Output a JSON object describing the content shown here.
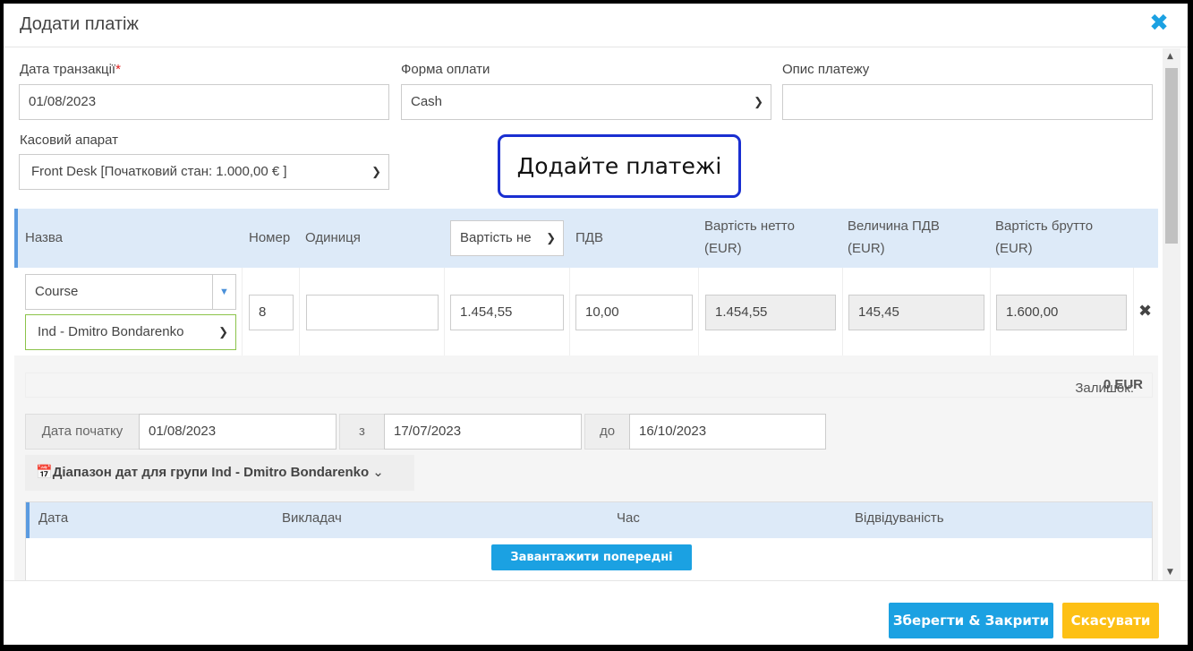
{
  "dialog": {
    "title": "Додати платіж",
    "close_icon": "close-icon"
  },
  "form": {
    "transaction_date": {
      "label": "Дата транзакції",
      "required_mark": "*",
      "value": "01/08/2023"
    },
    "payment_method": {
      "label": "Форма оплати",
      "value": "Cash"
    },
    "description": {
      "label": "Опис платежу",
      "value": ""
    },
    "cash_register": {
      "label": "Касовий апарат",
      "value": "Front Desk [Початковий стан: 1.000,00 € ]"
    }
  },
  "callout": {
    "text": "Додайте платежі"
  },
  "items_table": {
    "headers": {
      "name": "Назва",
      "number": "Номер",
      "unit": "Одиниця",
      "cost_select": "Вартість не",
      "vat": "ПДВ",
      "net": [
        "Вартість нетто",
        "(EUR)"
      ],
      "vat_amount": [
        "Величина ПДВ",
        "(EUR)"
      ],
      "gross": [
        "Вартість брутто",
        "(EUR)"
      ]
    },
    "row": {
      "product": "Course",
      "group": "Ind - Dmitro Bondarenko",
      "number": "8",
      "unit": "",
      "cost": "1.454,55",
      "vat": "10,00",
      "net": "1.454,55",
      "vat_amount": "145,45",
      "gross": "1.600,00"
    },
    "balance_label": "Залишок:",
    "balance_value": "0 EUR"
  },
  "dates": {
    "start_label": "Дата початку",
    "start_value": "01/08/2023",
    "from_label": "з",
    "from_value": "17/07/2023",
    "to_label": "до",
    "to_value": "16/10/2023"
  },
  "range_button": {
    "label": "Діапазон дат для групи Ind - Dmitro Bondarenko"
  },
  "lessons": {
    "headers": [
      "Дата",
      "Викладач",
      "Час",
      "Відвідуваність"
    ],
    "load_button": "Завантажити попередні уроки"
  },
  "footer": {
    "save_close": "Зберегти & Закрити",
    "cancel": "Скасувати"
  },
  "colors": {
    "accent": "#1ba1e2",
    "cancel": "#fdc015",
    "header_bg": "#ddeaf8",
    "callout_border": "#1a2fd1"
  }
}
